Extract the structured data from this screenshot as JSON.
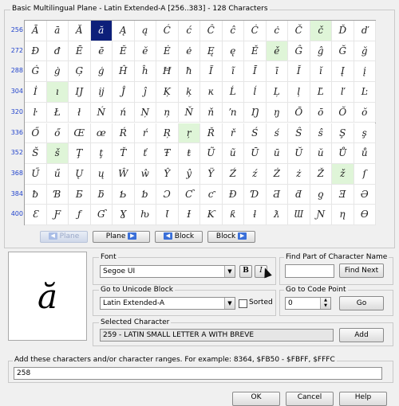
{
  "grid_title": "Basic Multilingual Plane - Latin Extended-A [256..383] - 128 Characters",
  "rows": [
    {
      "label": "256",
      "chars": [
        "Ā",
        "ā",
        "Ă",
        "ă",
        "Ą",
        "ą",
        "Ć",
        "ć",
        "Ĉ",
        "ĉ",
        "Ċ",
        "ċ",
        "Č",
        "č",
        "Ď",
        "ď"
      ]
    },
    {
      "label": "272",
      "chars": [
        "Đ",
        "đ",
        "Ē",
        "ē",
        "Ĕ",
        "ĕ",
        "Ė",
        "ė",
        "Ę",
        "ę",
        "Ě",
        "ě",
        "Ĝ",
        "ĝ",
        "Ğ",
        "ğ"
      ]
    },
    {
      "label": "288",
      "chars": [
        "Ġ",
        "ġ",
        "Ģ",
        "ģ",
        "Ĥ",
        "ĥ",
        "Ħ",
        "ħ",
        "Ĩ",
        "ĩ",
        "Ī",
        "ī",
        "Ĭ",
        "ĭ",
        "Į",
        "į"
      ]
    },
    {
      "label": "304",
      "chars": [
        "İ",
        "ı",
        "Ĳ",
        "ĳ",
        "Ĵ",
        "ĵ",
        "Ķ",
        "ķ",
        "ĸ",
        "Ĺ",
        "ĺ",
        "Ļ",
        "ļ",
        "Ľ",
        "ľ",
        "Ŀ"
      ]
    },
    {
      "label": "320",
      "chars": [
        "ŀ",
        "Ł",
        "ł",
        "Ń",
        "ń",
        "Ņ",
        "ņ",
        "Ň",
        "ň",
        "ŉ",
        "Ŋ",
        "ŋ",
        "Ō",
        "ō",
        "Ŏ",
        "ŏ"
      ]
    },
    {
      "label": "336",
      "chars": [
        "Ő",
        "ő",
        "Œ",
        "œ",
        "Ŕ",
        "ŕ",
        "Ŗ",
        "ŗ",
        "Ř",
        "ř",
        "Ś",
        "ś",
        "Ŝ",
        "ŝ",
        "Ş",
        "ş"
      ]
    },
    {
      "label": "352",
      "chars": [
        "Š",
        "š",
        "Ţ",
        "ţ",
        "Ť",
        "ť",
        "Ŧ",
        "ŧ",
        "Ũ",
        "ũ",
        "Ū",
        "ū",
        "Ŭ",
        "ŭ",
        "Ů",
        "ů"
      ]
    },
    {
      "label": "368",
      "chars": [
        "Ű",
        "ű",
        "Ų",
        "ų",
        "Ŵ",
        "ŵ",
        "Ŷ",
        "ŷ",
        "Ÿ",
        "Ź",
        "ź",
        "Ż",
        "ż",
        "Ž",
        "ž",
        "ſ"
      ]
    },
    {
      "label": "384",
      "chars": [
        "ƀ",
        "Ɓ",
        "Ƃ",
        "ƃ",
        "Ƅ",
        "ƅ",
        "Ɔ",
        "Ƈ",
        "ƈ",
        "Ɖ",
        "Ɗ",
        "Ƌ",
        "ƌ",
        "ƍ",
        "Ǝ",
        "Ə"
      ]
    },
    {
      "label": "400",
      "chars": [
        "Ɛ",
        "Ƒ",
        "ƒ",
        "Ɠ",
        "Ɣ",
        "ƕ",
        "Ɩ",
        "Ɨ",
        "Ƙ",
        "ƙ",
        "ƚ",
        "ƛ",
        "Ɯ",
        "Ɲ",
        "ƞ",
        "Ɵ"
      ]
    }
  ],
  "selected_index": [
    0,
    3
  ],
  "highlighted": [
    [
      0,
      13
    ],
    [
      1,
      11
    ],
    [
      3,
      1
    ],
    [
      5,
      7
    ],
    [
      6,
      1
    ],
    [
      7,
      14
    ]
  ],
  "nav": {
    "prev_plane": "Plane",
    "next_plane": "Plane",
    "prev_block": "Block",
    "next_block": "Block"
  },
  "preview_char": "ă",
  "font": {
    "label": "Font",
    "value": "Segoe UI",
    "bold": "B",
    "italic": "I"
  },
  "find": {
    "label": "Find Part of Character Name",
    "value": "",
    "button": "Find Next"
  },
  "goto_block": {
    "label": "Go to Unicode Block",
    "value": "Latin Extended-A",
    "sorted_label": "Sorted"
  },
  "goto_code": {
    "label": "Go to Code Point",
    "value": "0",
    "button": "Go"
  },
  "selected": {
    "label": "Selected Character",
    "value": "259 - LATIN SMALL LETTER A WITH BREVE",
    "button": "Add"
  },
  "add_chars": {
    "label": "Add these characters and/or character ranges. For example: 8364, $FB50 - $FBFF, $FFFC",
    "value": "258"
  },
  "footer": {
    "ok": "OK",
    "cancel": "Cancel",
    "help": "Help"
  },
  "colors": {
    "selection": "#0d1f7a",
    "highlight": "#dff5d8",
    "rowlabel": "#2244cc"
  }
}
